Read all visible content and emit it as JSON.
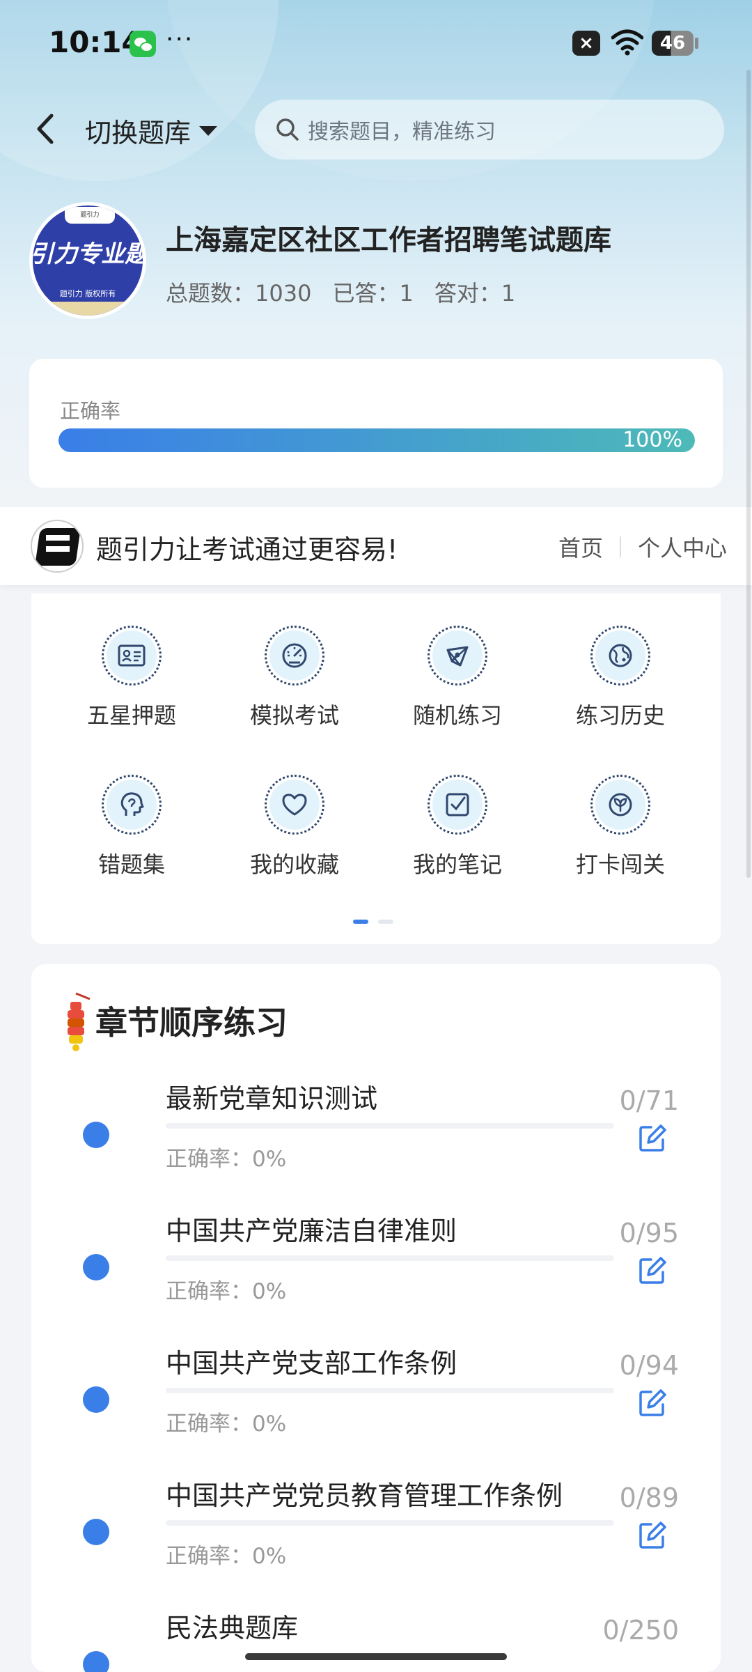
{
  "status_bar": {
    "time": "10:14",
    "dots": "···",
    "x_label": "×",
    "battery": "46"
  },
  "header": {
    "back_icon": "chevron-left-icon",
    "switch_label": "切换题库",
    "search_placeholder": "搜索题目，精准练习"
  },
  "bank": {
    "logo_tag": "题引力",
    "logo_text": "引力专业题",
    "logo_subtext": "题引力 版权所有",
    "title": "上海嘉定区社区工作者招聘笔试题库",
    "stats": [
      "总题数：1030",
      "已答：1",
      "答对：1"
    ]
  },
  "accuracy": {
    "label": "正确率",
    "value_percent": 100,
    "text": "100%"
  },
  "promo": {
    "text": "题引力让考试通过更容易!",
    "nav": [
      "首页",
      "个人中心"
    ]
  },
  "features": [
    {
      "label": "五星押题",
      "icon": "id-card-icon"
    },
    {
      "label": "模拟考试",
      "icon": "gauge-icon"
    },
    {
      "label": "随机练习",
      "icon": "shuffle-network-icon"
    },
    {
      "label": "练习历史",
      "icon": "globe-icon"
    },
    {
      "label": "错题集",
      "icon": "head-icon"
    },
    {
      "label": "我的收藏",
      "icon": "heart-icon"
    },
    {
      "label": "我的笔记",
      "icon": "note-check-icon"
    },
    {
      "label": "打卡闯关",
      "icon": "leaf-badge-icon"
    }
  ],
  "chapters": {
    "title": "章节顺序练习",
    "items": [
      {
        "name": "最新党章知识测试",
        "acc": "正确率：0%",
        "count": "0/71"
      },
      {
        "name": "中国共产党廉洁自律准则",
        "acc": "正确率：0%",
        "count": "0/95"
      },
      {
        "name": "中国共产党支部工作条例",
        "acc": "正确率：0%",
        "count": "0/94"
      },
      {
        "name": "中国共产党党员教育管理工作条例",
        "acc": "正确率：0%",
        "count": "0/89"
      },
      {
        "name": "民法典题库",
        "acc": "",
        "count": "0/250"
      }
    ]
  },
  "colors": {
    "accent": "#3a7ee8",
    "bar_end": "#4dbab8",
    "icon_stroke": "#30486e"
  }
}
